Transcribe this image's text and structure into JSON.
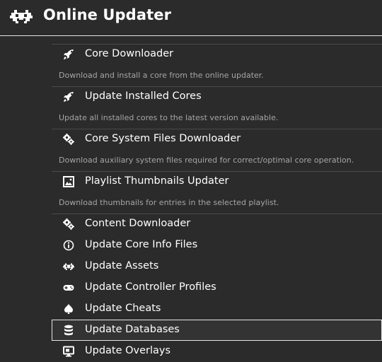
{
  "header": {
    "title": "Online Updater",
    "logo_icon": "retroarch-invader-icon"
  },
  "menu": {
    "items": [
      {
        "label": "Core Downloader",
        "icon": "rocket-icon",
        "description": "Download and install a core from the online updater."
      },
      {
        "label": "Update Installed Cores",
        "icon": "rocket-icon",
        "description": "Update all installed cores to the latest version available."
      },
      {
        "label": "Core System Files Downloader",
        "icon": "gears-icon",
        "description": "Download auxiliary system files required for correct/optimal core operation."
      },
      {
        "label": "Playlist Thumbnails Updater",
        "icon": "image-icon",
        "description": "Download thumbnails for entries in the selected playlist."
      },
      {
        "label": "Content Downloader",
        "icon": "gears-icon"
      },
      {
        "label": "Update Core Info Files",
        "icon": "info-icon"
      },
      {
        "label": "Update Assets",
        "icon": "retroarch-invader-icon"
      },
      {
        "label": "Update Controller Profiles",
        "icon": "gamepad-icon"
      },
      {
        "label": "Update Cheats",
        "icon": "spade-icon"
      },
      {
        "label": "Update Databases",
        "icon": "database-icon",
        "selected": true
      },
      {
        "label": "Update Overlays",
        "icon": "monitor-icon"
      }
    ]
  },
  "colors": {
    "background": "#2b2b2b",
    "text": "#ffffff",
    "description_text": "#a6a6a6",
    "separator": "#4a4a4a",
    "selection_border": "#e6e6e6"
  }
}
